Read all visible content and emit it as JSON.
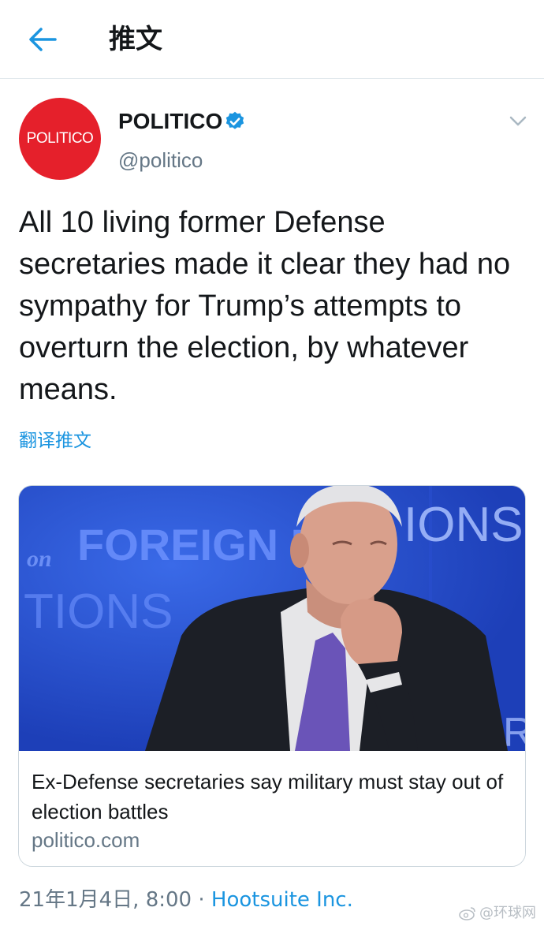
{
  "header": {
    "back_icon": "arrow-left-icon",
    "title": "推文"
  },
  "tweet": {
    "avatar_text": "POLITICO",
    "author_name": "POLITICO",
    "verified_icon": "verified-badge-icon",
    "handle": "@politico",
    "menu_icon": "chevron-down-icon",
    "text": "All 10 living former Defense secretaries made it clear they had no sympathy for Trump’s attempts to overturn the election, by whatever means.",
    "translate_label": "翻译推文",
    "timestamp": "21年1月4日, 8:00",
    "separator": " · ",
    "source": "Hootsuite Inc."
  },
  "card": {
    "image_text_line1_prefix": "on",
    "image_text_line1": "FOREIGN R",
    "image_text_line1_right": "IONS",
    "image_text_line2": "TIONS",
    "image_text_right_edge": "R",
    "title": "Ex-Defense secretaries say military must stay out of election battles",
    "domain": "politico.com"
  },
  "watermark": {
    "icon": "weibo-icon",
    "text": "@环球网"
  },
  "colors": {
    "accent": "#1b95e0",
    "brand_red": "#e5202b",
    "secondary_text": "#657786",
    "image_blue": "#1e44c6"
  }
}
